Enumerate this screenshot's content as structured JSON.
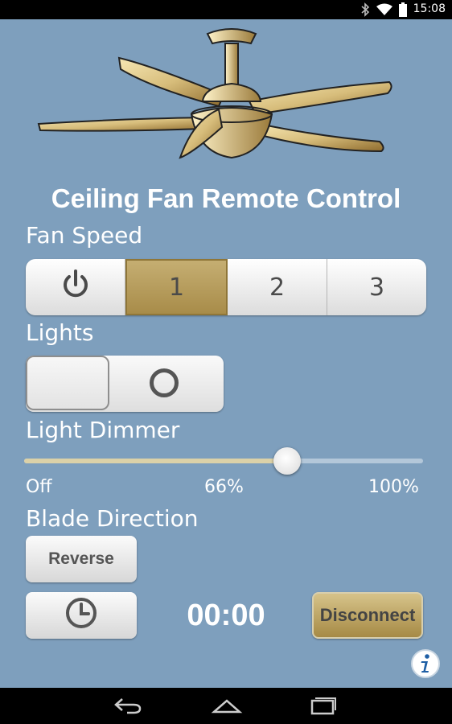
{
  "status_bar": {
    "time": "15:08",
    "icons": [
      "bluetooth-icon",
      "wifi-icon",
      "battery-icon"
    ]
  },
  "app": {
    "title": "Ceiling Fan Remote Control"
  },
  "fan_speed": {
    "label": "Fan Speed",
    "options": [
      "power-icon",
      "1",
      "2",
      "3"
    ],
    "selected": "1"
  },
  "lights": {
    "label": "Lights",
    "state": "off"
  },
  "dimmer": {
    "label": "Light Dimmer",
    "value_percent": 66,
    "min_label": "Off",
    "mid_label": "66%",
    "max_label": "100%"
  },
  "blade_direction": {
    "label": "Blade Direction",
    "reverse_label": "Reverse"
  },
  "timer": {
    "value": "00:00",
    "icon": "clock-icon"
  },
  "disconnect_label": "Disconnect",
  "colors": {
    "background": "#7e9fbd",
    "accent_gold": "#b89d58"
  },
  "nav": {
    "icons": [
      "back-icon",
      "home-icon",
      "recent-apps-icon"
    ]
  }
}
